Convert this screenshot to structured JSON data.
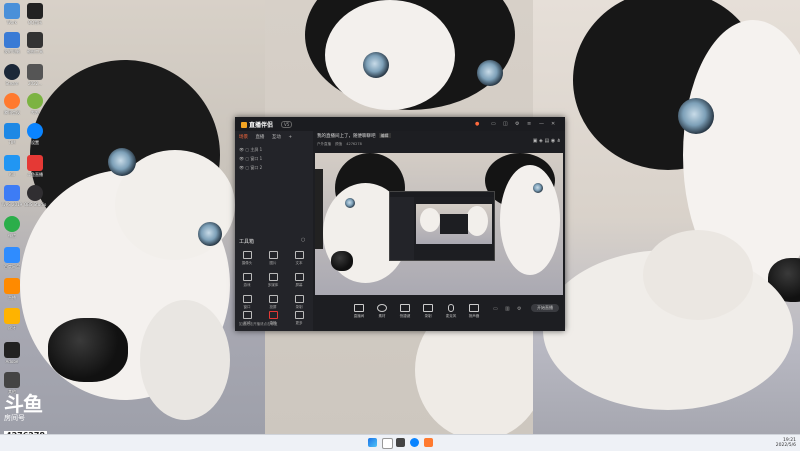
{
  "desktop_icons": [
    {
      "label": "Work",
      "icon": "folder-icon",
      "color": "#4a90d9"
    },
    {
      "label": "我的电脑",
      "icon": "computer-icon",
      "color": "#3a7bd5"
    },
    {
      "label": "Steam",
      "icon": "steam-icon",
      "color": "#1b2838"
    },
    {
      "label": "腾讯会议",
      "icon": "meeting-icon",
      "color": "#ff7a2f"
    },
    {
      "label": "TIM",
      "icon": "tim-icon",
      "color": "#1e88e5"
    },
    {
      "label": "Kill",
      "icon": "kill-icon",
      "color": "#2196f3"
    },
    {
      "label": "WPS 2019",
      "icon": "wps-icon",
      "color": "#3d7cf5"
    },
    {
      "label": "微信",
      "icon": "wechat-icon",
      "color": "#2bae4a"
    },
    {
      "label": "百度网盘",
      "icon": "netdisk-icon",
      "color": "#2f8cff"
    },
    {
      "label": "直播",
      "icon": "live-icon",
      "color": "#ff8a00"
    },
    {
      "label": "虎牙",
      "icon": "huya-icon",
      "color": "#ffb300"
    },
    {
      "label": "Adobe",
      "icon": "adobe-icon",
      "color": "#222"
    },
    {
      "label": "其他",
      "icon": "misc-icon",
      "color": "#444"
    }
  ],
  "desktop_icons_col2": [
    {
      "label": "QQ音乐",
      "icon": "music-icon",
      "color": "#222"
    },
    {
      "label": "截图工具",
      "icon": "snip-icon",
      "color": "#333"
    },
    {
      "label": "2022...",
      "icon": "file-icon",
      "color": "#555"
    },
    {
      "label": "哔哩",
      "icon": "bili-icon",
      "color": "#7cb342"
    },
    {
      "label": "设置",
      "icon": "settings-icon",
      "color": "#0a84ff"
    },
    {
      "label": "斗鱼直播",
      "icon": "douyu-icon",
      "color": "#e53935"
    },
    {
      "label": "OBS Studio",
      "icon": "obs-icon",
      "color": "#302e31"
    }
  ],
  "watermark": {
    "logo": "斗鱼",
    "sub": "房间号",
    "room": "4276278"
  },
  "app": {
    "title": "直播伴侣",
    "version": "V5",
    "tabs": [
      "场景",
      "直播",
      "互动",
      "+"
    ],
    "scenes": [
      "主屏 1",
      "窗口 1",
      "窗口 2"
    ],
    "tools_title": "工具箱",
    "tools": [
      {
        "label": "摄像头",
        "icon": "camera-tool-icon"
      },
      {
        "label": "图片",
        "icon": "image-tool-icon"
      },
      {
        "label": "文本",
        "icon": "text-tool-icon"
      },
      {
        "label": "游戏",
        "icon": "game-tool-icon"
      },
      {
        "label": "多媒体",
        "icon": "media-tool-icon"
      },
      {
        "label": "屏幕",
        "icon": "screen-tool-icon"
      },
      {
        "label": "窗口",
        "icon": "window-tool-icon"
      },
      {
        "label": "投屏",
        "icon": "cast-tool-icon"
      },
      {
        "label": "录制",
        "icon": "record-tool-icon"
      },
      {
        "label": "区域",
        "icon": "region-tool-icon"
      },
      {
        "label": "直播",
        "icon": "live-tool-icon"
      },
      {
        "label": "更多",
        "icon": "more-tool-icon"
      }
    ],
    "notice": "如遇无法开播请点击修复",
    "room_title": "我的直播间上了，随便聊聊吧",
    "room_edit": "编辑",
    "room_tags": [
      "户外直播",
      "颜值",
      "4276278"
    ],
    "bottom": [
      "直播间",
      "素材",
      "快捷键",
      "录制",
      "麦克风",
      "扬声器"
    ],
    "start_live": "开始直播"
  },
  "taskbar": {
    "time": "19:21",
    "date": "2022/5/6"
  }
}
